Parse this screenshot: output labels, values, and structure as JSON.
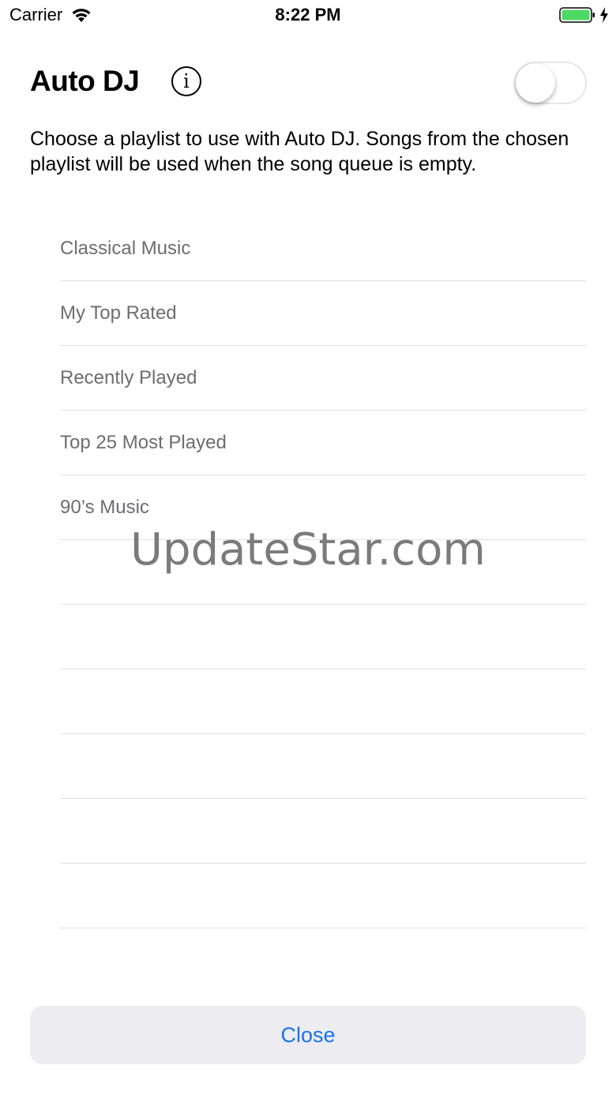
{
  "status_bar": {
    "carrier": "Carrier",
    "time": "8:22 PM",
    "wifi_icon": "wifi-icon",
    "battery_icon": "battery-full-icon",
    "charging_icon": "charging-bolt-icon",
    "battery_color": "#4cd964"
  },
  "header": {
    "title": "Auto DJ",
    "info_label": "i",
    "info_icon": "info-circle-icon",
    "toggle_on": false
  },
  "description": "Choose a playlist to use with Auto DJ. Songs from the chosen playlist will be used when the song queue is empty.",
  "playlists": [
    "Classical Music",
    "My Top Rated",
    "Recently Played",
    "Top 25 Most Played",
    "90’s Music",
    "",
    "",
    "",
    "",
    "",
    "",
    ""
  ],
  "watermark": "UpdateStar.com",
  "close_label": "Close",
  "accent_color": "#1a73e8"
}
